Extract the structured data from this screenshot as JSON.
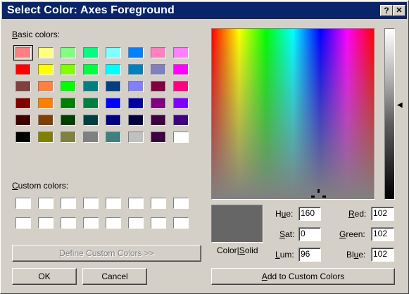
{
  "window": {
    "title": "Select Color: Axes Foreground",
    "help_glyph": "?",
    "close_glyph": "✕"
  },
  "basic_colors": {
    "label_accel": "B",
    "label_rest": "asic colors:",
    "rows": [
      [
        "#ff8080",
        "#ffff80",
        "#80ff80",
        "#00ff80",
        "#80ffff",
        "#0080ff",
        "#ff80c0",
        "#ff80ff"
      ],
      [
        "#ff0000",
        "#ffff00",
        "#80ff00",
        "#00ff40",
        "#00ffff",
        "#0080c0",
        "#8080c0",
        "#ff00ff"
      ],
      [
        "#804040",
        "#ff8040",
        "#00ff00",
        "#008080",
        "#004080",
        "#8080ff",
        "#800040",
        "#ff0080"
      ],
      [
        "#800000",
        "#ff8000",
        "#008000",
        "#008040",
        "#0000ff",
        "#0000a0",
        "#800080",
        "#8000ff"
      ],
      [
        "#400000",
        "#804000",
        "#004000",
        "#004040",
        "#000080",
        "#000040",
        "#400040",
        "#400080"
      ],
      [
        "#000000",
        "#808000",
        "#808040",
        "#808080",
        "#408080",
        "#c0c0c0",
        "#400040",
        "#ffffff"
      ]
    ],
    "selected": [
      0,
      0
    ]
  },
  "custom_colors": {
    "label_accel": "C",
    "label_rest": "ustom colors:",
    "rows": [
      [
        "#ffffff",
        "#ffffff",
        "#ffffff",
        "#ffffff",
        "#ffffff",
        "#ffffff",
        "#ffffff",
        "#ffffff"
      ],
      [
        "#ffffff",
        "#ffffff",
        "#ffffff",
        "#ffffff",
        "#ffffff",
        "#ffffff",
        "#ffffff",
        "#ffffff"
      ]
    ]
  },
  "buttons": {
    "define_accel": "D",
    "define_rest": "efine Custom Colors >>",
    "ok": "OK",
    "cancel": "Cancel",
    "add_accel": "A",
    "add_rest": "dd to Custom Colors"
  },
  "preview": {
    "color": "#666666",
    "label_a": "Color|",
    "label_accel": "S",
    "label_b": "olid"
  },
  "hsl": {
    "hue_accel": "u",
    "hue_pre": "H",
    "hue_post": "e:",
    "hue": "160",
    "sat_accel": "S",
    "sat_post": "at:",
    "sat": "0",
    "lum_accel": "L",
    "lum_post": "um:",
    "lum": "96"
  },
  "rgb": {
    "red_accel": "R",
    "red_post": "ed:",
    "red": "102",
    "green_accel": "G",
    "green_post": "reen:",
    "green": "102",
    "blue_pre": "Bl",
    "blue_accel": "u",
    "blue_post": "e:",
    "blue": "102"
  },
  "luminance_arrow": "◀",
  "luminance_level": 0.45
}
